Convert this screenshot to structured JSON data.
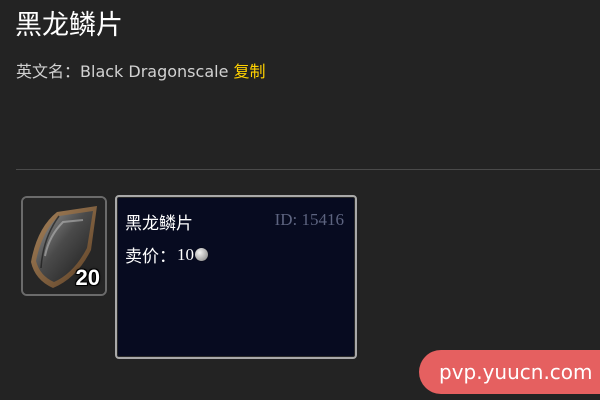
{
  "item": {
    "name": "黑龙鳞片",
    "english_label": "英文名：",
    "english_name": "Black Dragonscale",
    "copy_label": "复制"
  },
  "icon": {
    "name": "black-dragonscale-icon",
    "stack_count": "20"
  },
  "tooltip": {
    "name": "黑龙鳞片",
    "id_text": "ID: 15416",
    "sell_label": "卖价：",
    "sell_value": "10",
    "coin_icon": "silver-coin-icon"
  },
  "watermark": {
    "text": "pvp.yuucn.com"
  },
  "colors": {
    "background": "#232323",
    "copy_link": "#ffd100",
    "tooltip_bg": "#070b20",
    "tooltip_border": "#a9a9a9",
    "id_text": "#5d6480",
    "watermark_bg": "#f06464"
  }
}
